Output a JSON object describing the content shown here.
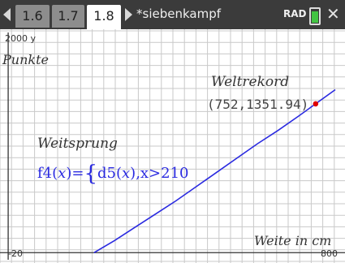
{
  "tabs": [
    {
      "label": "1.6",
      "active": false
    },
    {
      "label": "1.7",
      "active": false
    },
    {
      "label": "1.8",
      "active": true
    }
  ],
  "document_title": "*siebenkampf",
  "angle_mode": "RAD",
  "battery_color": "#43c443",
  "icons": [
    "nav-left-icon",
    "nav-right-icon",
    "battery-icon",
    "close-icon"
  ],
  "graph": {
    "y_max_label": "2000 y",
    "y_axis_label": "Punkte",
    "x_axis_label": "Weite in cm",
    "y_min_label": "-20",
    "x_max_label": "800",
    "point_label": "Weltrekord",
    "point_coords": "(752,1351.94)",
    "function_label": "Weitsprung",
    "function_definition": {
      "name": "f4",
      "arg": "x",
      "eq": "=",
      "brace": "{",
      "body_fn": "d5",
      "body_arg": "x",
      "condition": ",x>210"
    },
    "curve_color": "#2a2ae0",
    "point_color": "#e00000"
  },
  "chart_data": {
    "type": "line",
    "xlim": [
      -20,
      800
    ],
    "ylim": [
      -20,
      2000
    ],
    "grid": true,
    "series": [
      {
        "x": [
          210,
          260,
          310,
          360,
          410,
          460,
          510,
          560,
          610,
          660,
          710,
          752,
          800
        ],
        "y": [
          0,
          110,
          230,
          350,
          470,
          600,
          730,
          860,
          990,
          1110,
          1240,
          1351.94,
          1480
        ]
      }
    ],
    "points": [
      {
        "x": 752,
        "y": 1351.94
      }
    ]
  }
}
